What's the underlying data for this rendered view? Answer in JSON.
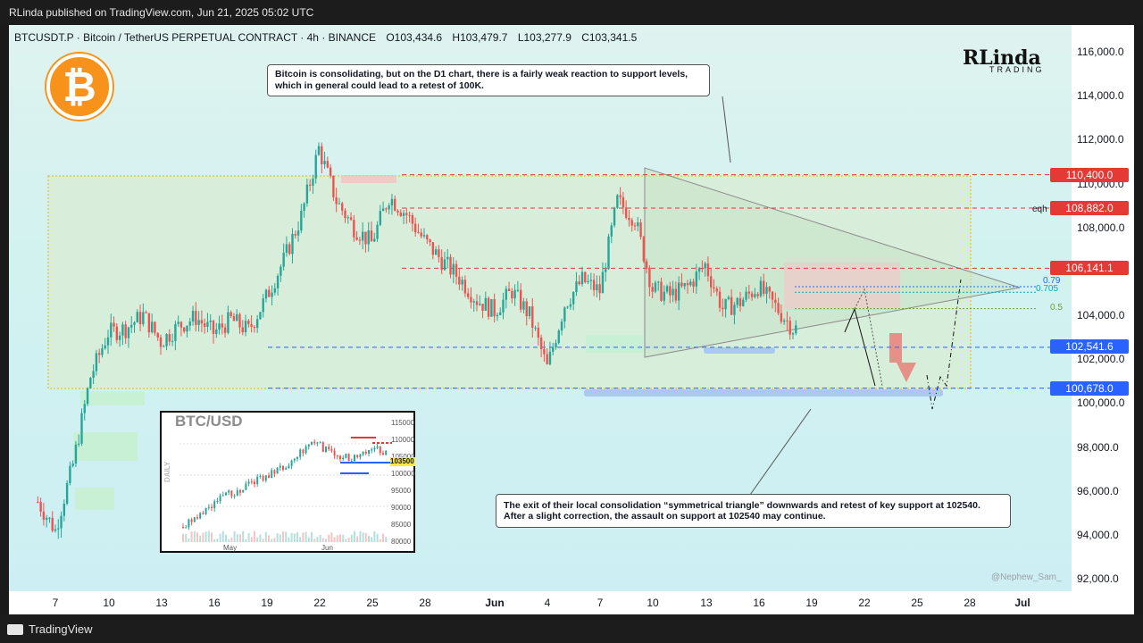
{
  "header": {
    "published": "RLinda published on TradingView.com, Jun 21, 2025 05:02 UTC",
    "symbol": "BTCUSDT.P · Bitcoin / TetherUS PERPETUAL CONTRACT · 4h · BINANCE",
    "open": "O103,434.6",
    "high": "H103,479.7",
    "low": "L103,277.9",
    "close": "C103,341.5"
  },
  "brand": {
    "name": "RLinda",
    "sub": "TRADING"
  },
  "logo": {
    "icon": "bitcoin-icon",
    "glyph": "₿",
    "color": "#f7931a"
  },
  "footer": {
    "brand": "TradingView"
  },
  "watermark": "@Nephew_Sam_",
  "callouts": {
    "top_line1": "Bitcoin is consolidating, but on the D1 chart, there is a fairly weak reaction to support levels,",
    "top_line2": "which in general could lead to a retest of 100K.",
    "bottom_line1": "The exit of their local consolidation “symmetrical triangle” downwards and retest of key support at 102540.",
    "bottom_line2": "After a slight correction, the assault on support at 102540 may continue."
  },
  "levels": {
    "poi_top_label": "poi",
    "poi_top": "110,400.0",
    "eqh_label": "eqh (lq)",
    "eqh": "108,882.0",
    "mid": "106,141.1",
    "support": "102,541.6",
    "poi_bottom_label": "poi",
    "poi_bottom": "100,678.0",
    "fib_079": "0.79",
    "fib_0705": "0.705",
    "fib_05": "0.5"
  },
  "colors": {
    "bull": "#26a69a",
    "bear": "#ef5350",
    "level_red": "#e53935",
    "level_blue": "#2962ff",
    "arrow": "#ef5350"
  },
  "chart_data": {
    "type": "candlestick",
    "symbol": "BTCUSDT.P",
    "interval": "4h",
    "x_ticks": [
      "7",
      "10",
      "13",
      "16",
      "19",
      "22",
      "25",
      "28",
      "Jun",
      "4",
      "7",
      "10",
      "13",
      "16",
      "19",
      "22",
      "25",
      "28",
      "Jul"
    ],
    "y_ticks": [
      "116,000.0",
      "114,000.0",
      "112,000.0",
      "110,000.0",
      "108,000.0",
      "104,000.0",
      "102,000.0",
      "100,000.0",
      "98,000.0",
      "96,000.0",
      "94,000.0",
      "92,000.0"
    ],
    "ylim": [
      91700,
      117200
    ],
    "close_path": [
      [
        6,
        95500
      ],
      [
        7,
        94200
      ],
      [
        8,
        97200
      ],
      [
        9,
        101200
      ],
      [
        10,
        103200
      ],
      [
        11,
        103400
      ],
      [
        12,
        104000
      ],
      [
        13,
        102800
      ],
      [
        14,
        103500
      ],
      [
        15,
        103900
      ],
      [
        16,
        103200
      ],
      [
        17,
        103800
      ],
      [
        18,
        103300
      ],
      [
        19,
        104800
      ],
      [
        20,
        106500
      ],
      [
        21,
        108500
      ],
      [
        22,
        111600
      ],
      [
        23,
        109200
      ],
      [
        24,
        108000
      ],
      [
        25,
        107300
      ],
      [
        26,
        109400
      ],
      [
        27,
        108600
      ],
      [
        28,
        107400
      ],
      [
        29,
        106500
      ],
      [
        30,
        105700
      ],
      [
        31,
        104700
      ],
      [
        32,
        104200
      ],
      [
        33,
        105100
      ],
      [
        34,
        104000
      ],
      [
        35,
        101600
      ],
      [
        36,
        104500
      ],
      [
        37,
        105600
      ],
      [
        38,
        105100
      ],
      [
        39,
        109200
      ],
      [
        40,
        108400
      ],
      [
        41,
        105200
      ],
      [
        42,
        104900
      ],
      [
        43,
        105300
      ],
      [
        44,
        106300
      ],
      [
        45,
        104300
      ],
      [
        46,
        104600
      ],
      [
        47,
        105300
      ],
      [
        48,
        104400
      ],
      [
        49,
        103400
      ]
    ],
    "levels": [
      110400,
      108882,
      106141.1,
      102541.6,
      100678.0
    ],
    "fib_levels": [
      {
        "label": "0.79",
        "value": 105300
      },
      {
        "label": "0.705",
        "value": 105050
      },
      {
        "label": "0.5",
        "value": 104300
      }
    ]
  },
  "inset": {
    "title": "BTC/USD",
    "side_label": "DAILY",
    "y_ticks": [
      "115000",
      "110000",
      "105000",
      "100000",
      "95000",
      "90000",
      "85000",
      "80000"
    ],
    "x_ticks": [
      "May",
      "Jun"
    ],
    "price_tag": "103500"
  }
}
